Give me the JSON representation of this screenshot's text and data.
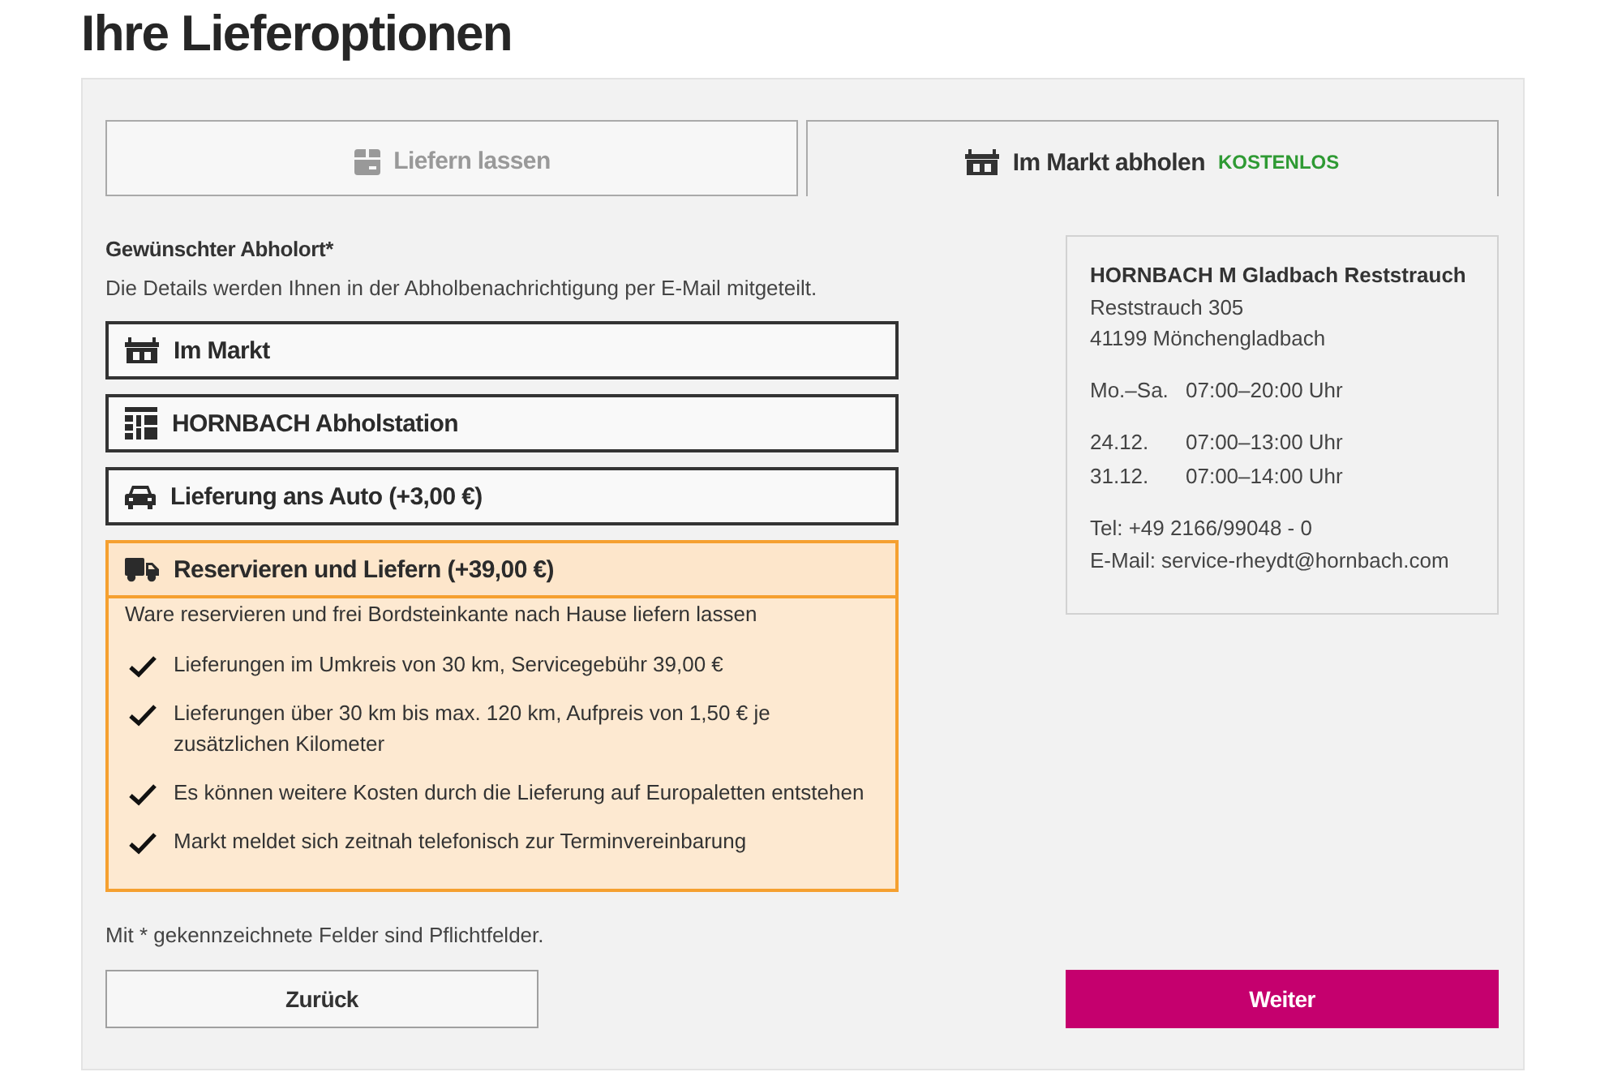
{
  "page_title": "Ihre Lieferoptionen",
  "tabs": [
    {
      "kind": "delivery",
      "label": "Liefern lassen",
      "selected": false
    },
    {
      "kind": "pickup",
      "label": "Im Markt abholen",
      "badge": "KOSTENLOS",
      "selected": true
    }
  ],
  "pickup_location": {
    "label": "Gewünschter Abholort*",
    "hint": "Die Details werden Ihnen in der Abholbenachrichtigung per E-Mail mitgeteilt.",
    "options": [
      {
        "kind": "store",
        "label": "Im Markt",
        "selected": false
      },
      {
        "kind": "station",
        "label": "HORNBACH Abholstation",
        "selected": false
      },
      {
        "kind": "car",
        "label": "Lieferung ans Auto (+3,00 €)",
        "selected": false
      },
      {
        "kind": "truck",
        "label": "Reservieren und Liefern (+39,00 €)",
        "selected": true,
        "details": {
          "intro": "Ware reservieren und frei Bordsteinkante nach Hause liefern lassen",
          "points": [
            "Lieferungen im Umkreis von 30 km, Servicegebühr 39,00 €",
            "Lieferungen über 30 km bis max. 120 km, Aufpreis von 1,50 € je zusätzlichen Kilometer",
            "Es können weitere Kosten durch die Lieferung auf Europaletten entstehen",
            "Markt meldet sich zeitnah telefonisch zur Terminvereinbarung"
          ]
        }
      }
    ]
  },
  "store": {
    "name": "HORNBACH M Gladbach Reststrauch",
    "address": [
      "Reststrauch 305",
      "41199 Mönchengladbach"
    ],
    "hours_groups": [
      [
        {
          "days": "Mo.–Sa.",
          "time": "07:00–20:00 Uhr"
        }
      ],
      [
        {
          "days": "24.12.",
          "time": "07:00–13:00 Uhr"
        },
        {
          "days": "31.12.",
          "time": "07:00–14:00 Uhr"
        }
      ]
    ],
    "contact": [
      "Tel: +49 2166/99048 - 0",
      "E-Mail: service-rheydt@hornbach.com"
    ]
  },
  "required_note": "Mit * gekennzeichnete Felder sind Pflichtfelder.",
  "buttons": [
    {
      "kind": "secondary",
      "label": "Zurück"
    },
    {
      "kind": "primary",
      "label": "Weiter"
    }
  ]
}
